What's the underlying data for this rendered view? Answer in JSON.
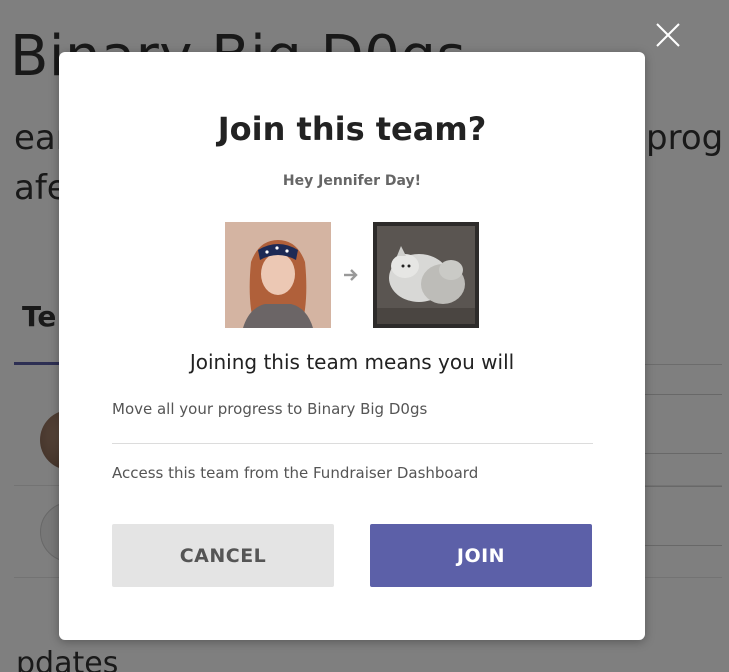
{
  "background": {
    "team_name_partial": "Binary Big D0gs",
    "description_line1_partial": "ear",
    "description_line1_right_partial": "prog",
    "description_line2_partial": "afe",
    "tab_partial": "Te",
    "updates_partial": "pdates"
  },
  "modal": {
    "title": "Join this team?",
    "greeting": "Hey Jennifer Day!",
    "subheading": "Joining this team means you will",
    "benefits": [
      "Move all your progress to Binary Big D0gs",
      "Access this team from the Fundraiser Dashboard"
    ],
    "cancel_label": "CANCEL",
    "join_label": "JOIN"
  },
  "icons": {
    "close": "close-icon",
    "arrow": "arrow-right-icon"
  },
  "colors": {
    "overlay": "rgba(0,0,0,0.5)",
    "join_button": "#5c60a8",
    "cancel_button": "#e4e4e4",
    "accent": "#5b5ea6"
  }
}
